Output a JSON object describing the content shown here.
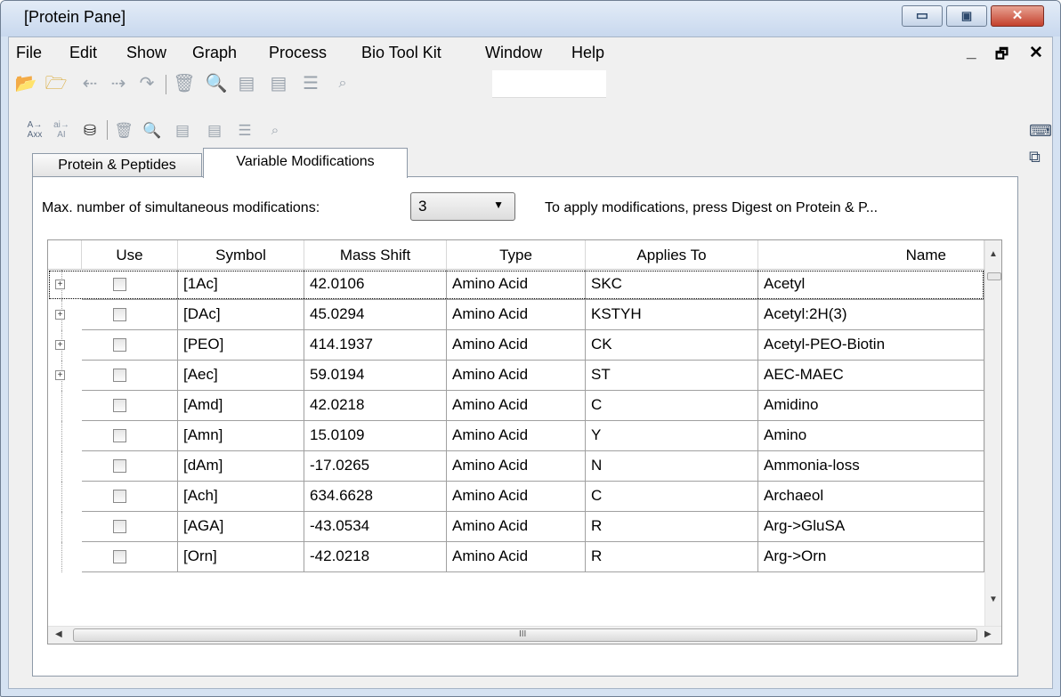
{
  "window": {
    "title": "[Protein Pane]",
    "controls": {
      "minimize": "▭",
      "maximize": "▣",
      "close": "✕"
    }
  },
  "menubar": {
    "items": [
      "File",
      "Edit",
      "Show",
      "Graph",
      "Process",
      "Bio Tool Kit",
      "Window",
      "Help"
    ],
    "mdi_controls": {
      "minimize": "_",
      "restore": "🗗",
      "close": "✕"
    }
  },
  "toolbar_main": {
    "icons": [
      "open-folder-icon",
      "open-multiple-folder-icon",
      "undo-icon",
      "redo-icon",
      "redo-all-icon",
      "delete-icon",
      "zoom-icon",
      "table-view-icon",
      "table-view-alt-icon",
      "list-view-icon",
      "find-icon"
    ]
  },
  "toolbar_pane": {
    "icons": [
      "sequence-format-icon",
      "sequence-case-icon",
      "binoculars-icon",
      "delete-icon",
      "zoom-icon",
      "table-view-icon",
      "table-view-alt-icon",
      "list-view-icon",
      "find-icon"
    ],
    "labels": {
      "seq_format_top": "A→",
      "seq_format_bottom": "Axx",
      "seq_case_top": "ai→",
      "seq_case_bottom": "AI"
    }
  },
  "tabs": {
    "protein_peptides": "Protein & Peptides",
    "variable_modifications": "Variable Modifications"
  },
  "variable_modifications": {
    "max_mods_label": "Max. number of simultaneous modifications:",
    "max_mods_value": "3",
    "hint": "To apply modifications, press Digest on Protein & P..."
  },
  "table": {
    "columns": [
      "Use",
      "Symbol",
      "Mass Shift",
      "Type",
      "Applies To",
      "Name"
    ],
    "rows": [
      {
        "expandable": true,
        "use": false,
        "symbol": "[1Ac]",
        "mass_shift": "42.0106",
        "type": "Amino Acid",
        "applies_to": "SKC",
        "name": "Acetyl"
      },
      {
        "expandable": true,
        "use": false,
        "symbol": "[DAc]",
        "mass_shift": "45.0294",
        "type": "Amino Acid",
        "applies_to": "KSTYH",
        "name": "Acetyl:2H(3)"
      },
      {
        "expandable": true,
        "use": false,
        "symbol": "[PEO]",
        "mass_shift": "414.1937",
        "type": "Amino Acid",
        "applies_to": "CK",
        "name": "Acetyl-PEO-Biotin"
      },
      {
        "expandable": true,
        "use": false,
        "symbol": "[Aec]",
        "mass_shift": "59.0194",
        "type": "Amino Acid",
        "applies_to": "ST",
        "name": "AEC-MAEC"
      },
      {
        "expandable": false,
        "use": false,
        "symbol": "[Amd]",
        "mass_shift": "42.0218",
        "type": "Amino Acid",
        "applies_to": "C",
        "name": "Amidino"
      },
      {
        "expandable": false,
        "use": false,
        "symbol": "[Amn]",
        "mass_shift": "15.0109",
        "type": "Amino Acid",
        "applies_to": "Y",
        "name": "Amino"
      },
      {
        "expandable": false,
        "use": false,
        "symbol": "[dAm]",
        "mass_shift": "-17.0265",
        "type": "Amino Acid",
        "applies_to": "N",
        "name": "Ammonia-loss"
      },
      {
        "expandable": false,
        "use": false,
        "symbol": "[Ach]",
        "mass_shift": "634.6628",
        "type": "Amino Acid",
        "applies_to": "C",
        "name": "Archaeol"
      },
      {
        "expandable": false,
        "use": false,
        "symbol": "[AGA]",
        "mass_shift": "-43.0534",
        "type": "Amino Acid",
        "applies_to": "R",
        "name": "Arg->GluSA"
      },
      {
        "expandable": false,
        "use": false,
        "symbol": "[Orn]",
        "mass_shift": "-42.0218",
        "type": "Amino Acid",
        "applies_to": "R",
        "name": "Arg->Orn"
      }
    ]
  },
  "scrollbar": {
    "up": "▲",
    "down": "▼",
    "left": "◀",
    "right": "▶",
    "grip": "III"
  }
}
